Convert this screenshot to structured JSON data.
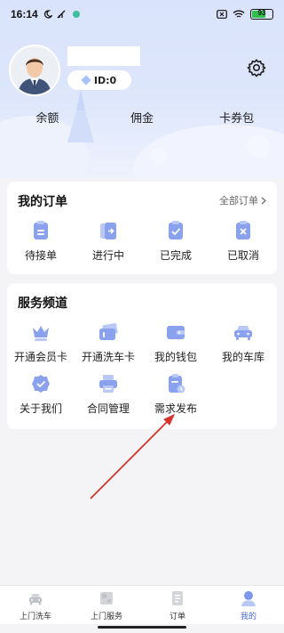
{
  "status_bar": {
    "time": "16:14",
    "battery": "93"
  },
  "profile": {
    "id_label": "ID:0"
  },
  "wallet": {
    "items": [
      "余额",
      "佣金",
      "卡券包"
    ]
  },
  "orders": {
    "title": "我的订单",
    "more": "全部订单",
    "items": [
      {
        "label": "待接单",
        "icon": "pending-icon"
      },
      {
        "label": "进行中",
        "icon": "in-progress-icon"
      },
      {
        "label": "已完成",
        "icon": "completed-icon"
      },
      {
        "label": "已取消",
        "icon": "cancelled-icon"
      }
    ]
  },
  "services": {
    "title": "服务频道",
    "items": [
      {
        "label": "开通会员卡",
        "icon": "crown-icon"
      },
      {
        "label": "开通洗车卡",
        "icon": "card-icon"
      },
      {
        "label": "我的钱包",
        "icon": "wallet-icon"
      },
      {
        "label": "我的车库",
        "icon": "car-icon"
      },
      {
        "label": "关于我们",
        "icon": "badge-icon"
      },
      {
        "label": "合同管理",
        "icon": "printer-icon"
      },
      {
        "label": "需求发布",
        "icon": "publish-icon"
      }
    ]
  },
  "tabbar": {
    "items": [
      {
        "label": "上门洗车",
        "icon": "car-wash-icon",
        "active": false
      },
      {
        "label": "上门服务",
        "icon": "service-icon",
        "active": false
      },
      {
        "label": "订单",
        "icon": "order-icon",
        "active": false
      },
      {
        "label": "我的",
        "icon": "profile-icon",
        "active": true
      }
    ]
  },
  "colors": {
    "accent": "#4a6be0",
    "icon_fill": "#8aa2ee",
    "annotation_arrow": "#d9342b"
  }
}
